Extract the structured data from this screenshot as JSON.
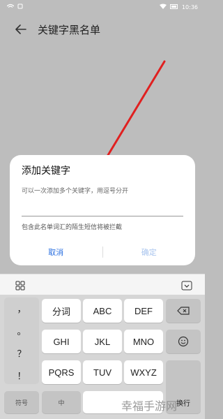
{
  "status_bar": {
    "time": "10:36"
  },
  "app_bar": {
    "title": "关键字黑名单"
  },
  "dialog": {
    "title": "添加关键字",
    "input_placeholder": "可以一次添加多个关键字，用逗号分开",
    "hint": "包含此名单词汇的陌生短信将被拦截",
    "cancel_label": "取消",
    "confirm_label": "确定"
  },
  "keyboard": {
    "punctuation": [
      "，",
      "。",
      "？",
      "！"
    ],
    "row1": [
      "分词",
      "ABC",
      "DEF"
    ],
    "row2": [
      "GHI",
      "JKL",
      "MNO"
    ],
    "row3": [
      "PQRS",
      "TUV",
      "WXYZ"
    ],
    "bottom": {
      "symbols": "符号",
      "lang": "中",
      "enter": "换行"
    }
  },
  "watermark": "幸福手游网",
  "colors": {
    "accent": "#2a6fe0",
    "arrow": "#e02020"
  }
}
